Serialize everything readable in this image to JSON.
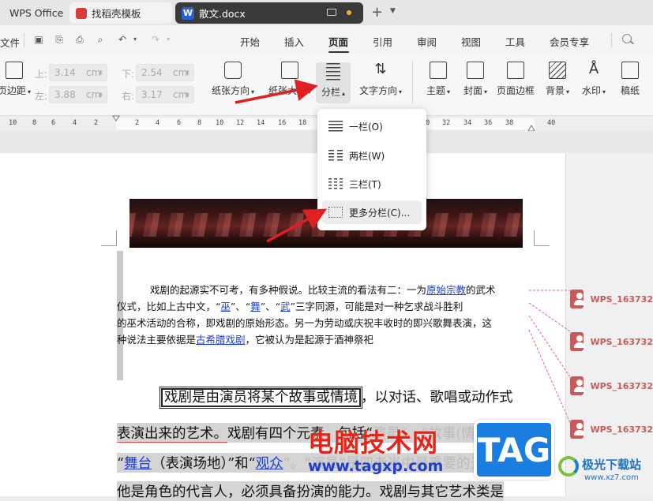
{
  "titlebar": {
    "app_name": "WPS Office",
    "tab_template": "找稻壳模板",
    "tab_doc": "散文.docx",
    "doc_icon_letter": "W"
  },
  "menubar": {
    "file": "文件",
    "items": [
      "开始",
      "插入",
      "页面",
      "引用",
      "审阅",
      "视图",
      "工具",
      "会员专享"
    ],
    "active": "页面"
  },
  "ribbon": {
    "margins_label": "页边距",
    "top_label": "上:",
    "top_value": "3.14",
    "top_unit": "cm",
    "bottom_label": "下:",
    "bottom_value": "2.54",
    "bottom_unit": "cm",
    "left_label": "左:",
    "left_value": "3.88",
    "left_unit": "cm",
    "right_label": "右:",
    "right_value": "3.17",
    "right_unit": "cm",
    "orientation": "纸张方向",
    "size": "纸张大小",
    "columns": "分栏",
    "text_direction": "文字方向",
    "theme": "主题",
    "cover": "封面",
    "page_border": "页面边框",
    "background": "背景",
    "watermark": "水印",
    "paper": "稿纸"
  },
  "ruler": {
    "ticks": [
      "10",
      "8",
      "6",
      "4",
      "2",
      "",
      "2",
      "4",
      "6",
      "8",
      "10",
      "12",
      "14",
      "16",
      "18",
      "30",
      "32",
      "34",
      "36",
      "38",
      "40"
    ]
  },
  "columns_menu": {
    "items": [
      "一栏(O)",
      "两栏(W)",
      "三栏(T)",
      "更多分栏(C)..."
    ],
    "hovered_index": 3
  },
  "document": {
    "p1_line1_a": "戏剧的起源实不可考，有多种假说。比较主流的看法有二：一为",
    "p1_line1_link": "原始宗教",
    "p1_line1_b": "的武术",
    "p1_line2_a": "仪式，比如上古中文，“",
    "p1_line2_l1": "巫",
    "p1_line2_b": "”、“",
    "p1_line2_l2": "舞",
    "p1_line2_c": "”、“",
    "p1_line2_l3": "武",
    "p1_line2_d": "”三字同源，可能是对一种乞求战斗胜利",
    "p1_line3": "的巫术活动的合称，即戏剧的原始形态。另一为劳动或庆祝丰收时的即兴歌舞表演，这",
    "p1_line4_a": "种说法主要依据是",
    "p1_line4_link": "古希腊戏剧",
    "p1_line4_b": "，它被认为是起源于酒神祭祀",
    "p2_line1_boxed": "戏剧是由演员将某个故事或情境",
    "p2_line1_rest": "，以对话、歌唱或动作式",
    "p2_line2_a": "表演出来的艺术。",
    "p2_line2_b": "戏剧有四个元素，包括“",
    "p2_line2_faded": "演员”、“故事(情境)”、",
    "p2_line3_a": "“",
    "p2_line3_link1": "舞台",
    "p2_line3_b": "（表演场地）”和“",
    "p2_line3_link2": "观众",
    "p2_line3_c": "”。“演员”是四者当中最重要的元素",
    "p2_line4": "他是角色的代言人，必须具备扮演的能力。戏剧与其它艺术类是"
  },
  "comments": {
    "author": "WPS_163732"
  },
  "watermarks": {
    "site_cn": "电脑技术网",
    "site_url": "www.tagxp.com",
    "tag": "TAG",
    "brand_cn": "极光下载站",
    "brand_url": "www.xz7.com"
  }
}
